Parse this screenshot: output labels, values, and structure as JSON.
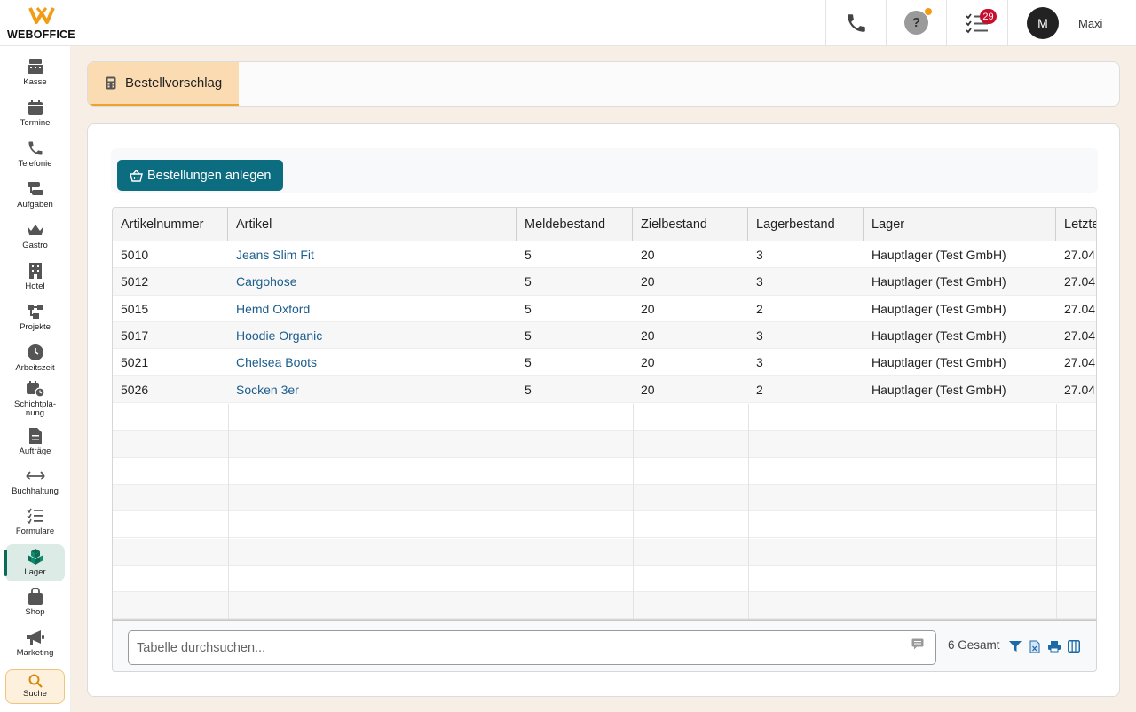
{
  "app": {
    "logo_text": "WEBOFFICE"
  },
  "header": {
    "help_label": "?",
    "tasks_badge": "29",
    "user": {
      "initial": "M",
      "name": "Maxi"
    }
  },
  "sidebar": {
    "items": [
      {
        "label": "Kasse",
        "icon": "register-icon"
      },
      {
        "label": "Termine",
        "icon": "calendar-icon"
      },
      {
        "label": "Telefonie",
        "icon": "phone-icon"
      },
      {
        "label": "Aufgaben",
        "icon": "tasks-icon"
      },
      {
        "label": "Gastro",
        "icon": "crown-icon"
      },
      {
        "label": "Hotel",
        "icon": "building-icon"
      },
      {
        "label": "Projekte",
        "icon": "project-icon"
      },
      {
        "label": "Arbeitszeit",
        "icon": "clock-icon"
      },
      {
        "label": "Schichtpla-",
        "label2": "nung",
        "icon": "shift-calendar-icon"
      },
      {
        "label": "Aufträge",
        "icon": "document-icon"
      },
      {
        "label": "Buchhaltung",
        "icon": "arrows-icon"
      },
      {
        "label": "Formulare",
        "icon": "checklist-icon"
      },
      {
        "label": "Lager",
        "icon": "boxes-icon",
        "active": true
      },
      {
        "label": "Shop",
        "icon": "bag-icon"
      },
      {
        "label": "Marketing",
        "icon": "megaphone-icon"
      },
      {
        "label": "Suche",
        "icon": "search-icon"
      }
    ]
  },
  "tab": {
    "label": "Bestellvorschlag"
  },
  "toolbar": {
    "create_orders_label": "Bestellungen anlegen"
  },
  "table": {
    "columns": [
      "Artikelnummer",
      "Artikel",
      "Meldebestand",
      "Zielbestand",
      "Lagerbestand",
      "Lager",
      "Letzte"
    ],
    "rows": [
      [
        "5010",
        "Jeans Slim Fit",
        "5",
        "20",
        "3",
        "Hauptlager (Test GmbH)",
        "27.04"
      ],
      [
        "5012",
        "Cargohose",
        "5",
        "20",
        "3",
        "Hauptlager (Test GmbH)",
        "27.04"
      ],
      [
        "5015",
        "Hemd Oxford",
        "5",
        "20",
        "2",
        "Hauptlager (Test GmbH)",
        "27.04"
      ],
      [
        "5017",
        "Hoodie Organic",
        "5",
        "20",
        "3",
        "Hauptlager (Test GmbH)",
        "27.04"
      ],
      [
        "5021",
        "Chelsea Boots",
        "5",
        "20",
        "3",
        "Hauptlager (Test GmbH)",
        "27.04"
      ],
      [
        "5026",
        "Socken 3er",
        "5",
        "20",
        "2",
        "Hauptlager (Test GmbH)",
        "27.04"
      ]
    ]
  },
  "footer": {
    "search_placeholder": "Tabelle durchsuchen...",
    "total_text": "6 Gesamt"
  },
  "colors": {
    "primary": "#0c6c80",
    "tab_active_bg": "#fbdcb2",
    "tab_active_border": "#f0a32b",
    "link": "#1c5e8d",
    "badge": "#c8102e"
  }
}
